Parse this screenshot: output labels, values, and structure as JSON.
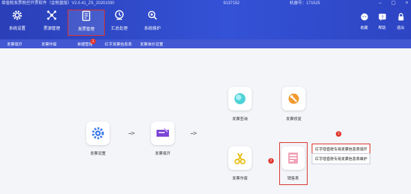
{
  "window": {
    "title": "增值税发票税控开票软件（金税盘版）V2.0.41_ZS_20201030",
    "id_1": "9137152",
    "id_2": "机器号：171525",
    "controls": [
      "–",
      "▢",
      "×"
    ]
  },
  "toolbar": {
    "items": [
      {
        "label": "系统设置",
        "icon": "gear-icon"
      },
      {
        "label": "票源管理",
        "icon": "network-icon"
      },
      {
        "label": "发票管理",
        "icon": "invoice-icon",
        "active": true
      },
      {
        "label": "汇总处理",
        "icon": "summary-icon"
      },
      {
        "label": "系统维护",
        "icon": "maintenance-icon"
      }
    ],
    "right_items": [
      {
        "label": "收藏",
        "icon": "star-icon"
      },
      {
        "label": "帮助",
        "icon": "help-icon"
      },
      {
        "label": "退出",
        "icon": "lock-icon"
      }
    ]
  },
  "subnav": {
    "items": [
      "发票填开",
      "发票作废",
      "单据管理",
      "红字发票信息表",
      "发票单价设置"
    ],
    "badge": "1"
  },
  "flow": {
    "nodes": {
      "setup": "发票设置",
      "fill": "发票填开",
      "query": "发票查询",
      "repair": "发票修复",
      "void": "发票作废",
      "list": "销售表"
    },
    "arrow": "-->",
    "callout_1": "1",
    "callout_2": "2",
    "menu": [
      "红字增值税专用发票信息表填开",
      "红字增值税专用发票信息表维护"
    ]
  },
  "colors": {
    "header": "#3452d6",
    "subnav": "#4257d2",
    "highlight": "#d92a22",
    "badge": "#e1352c"
  }
}
